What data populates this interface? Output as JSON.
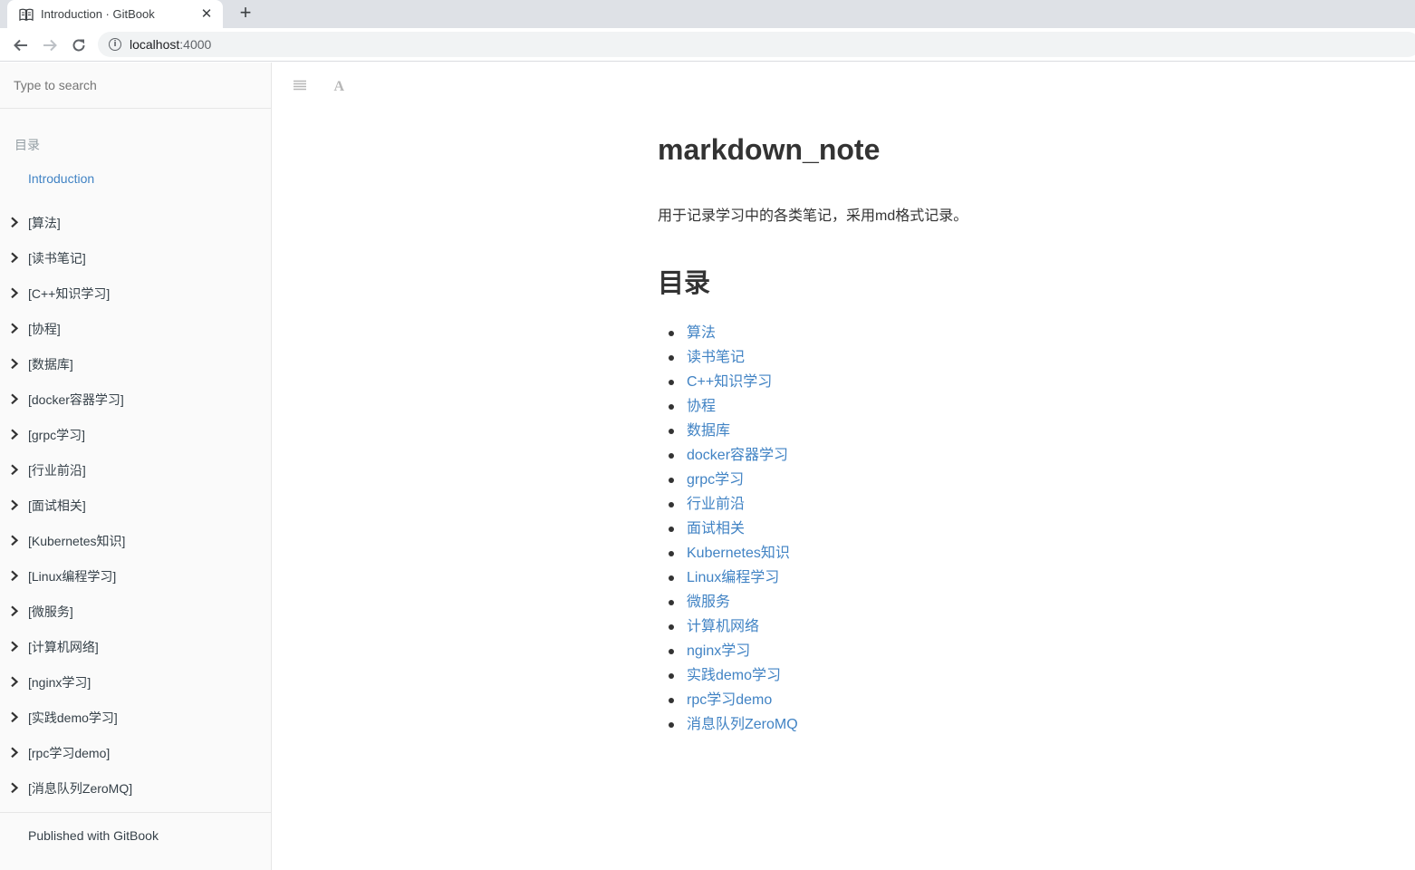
{
  "browser": {
    "tab_title": "Introduction · GitBook",
    "close_glyph": "✕",
    "new_tab_glyph": "+",
    "url_host": "localhost",
    "url_port": ":4000",
    "info_glyph": "i"
  },
  "sidebar": {
    "search_placeholder": "Type to search",
    "header": "目录",
    "items": [
      {
        "label": "Introduction",
        "active": true
      },
      {
        "label": "[算法]"
      },
      {
        "label": "[读书笔记]"
      },
      {
        "label": "[C++知识学习]"
      },
      {
        "label": "[协程]"
      },
      {
        "label": "[数据库]"
      },
      {
        "label": "[docker容器学习]"
      },
      {
        "label": "[grpc学习]"
      },
      {
        "label": "[行业前沿]"
      },
      {
        "label": "[面试相关]"
      },
      {
        "label": "[Kubernetes知识]"
      },
      {
        "label": "[Linux编程学习]"
      },
      {
        "label": "[微服务]"
      },
      {
        "label": "[计算机网络]"
      },
      {
        "label": "[nginx学习]"
      },
      {
        "label": "[实践demo学习]"
      },
      {
        "label": "[rpc学习demo]"
      },
      {
        "label": "[消息队列ZeroMQ]"
      }
    ],
    "published": "Published with GitBook"
  },
  "main": {
    "title": "markdown_note",
    "description": "用于记录学习中的各类笔记，采用md格式记录。",
    "toc_heading": "目录",
    "toc": [
      "算法",
      "读书笔记",
      "C++知识学习",
      "协程",
      "数据库",
      "docker容器学习",
      "grpc学习",
      "行业前沿",
      "面试相关",
      "Kubernetes知识",
      "Linux编程学习",
      "微服务",
      "计算机网络",
      "nginx学习",
      "实践demo学习",
      "rpc学习demo",
      "消息队列ZeroMQ"
    ]
  },
  "colors": {
    "link": "#4183c4",
    "sidebar_bg": "#fafafa",
    "text": "#333333"
  }
}
